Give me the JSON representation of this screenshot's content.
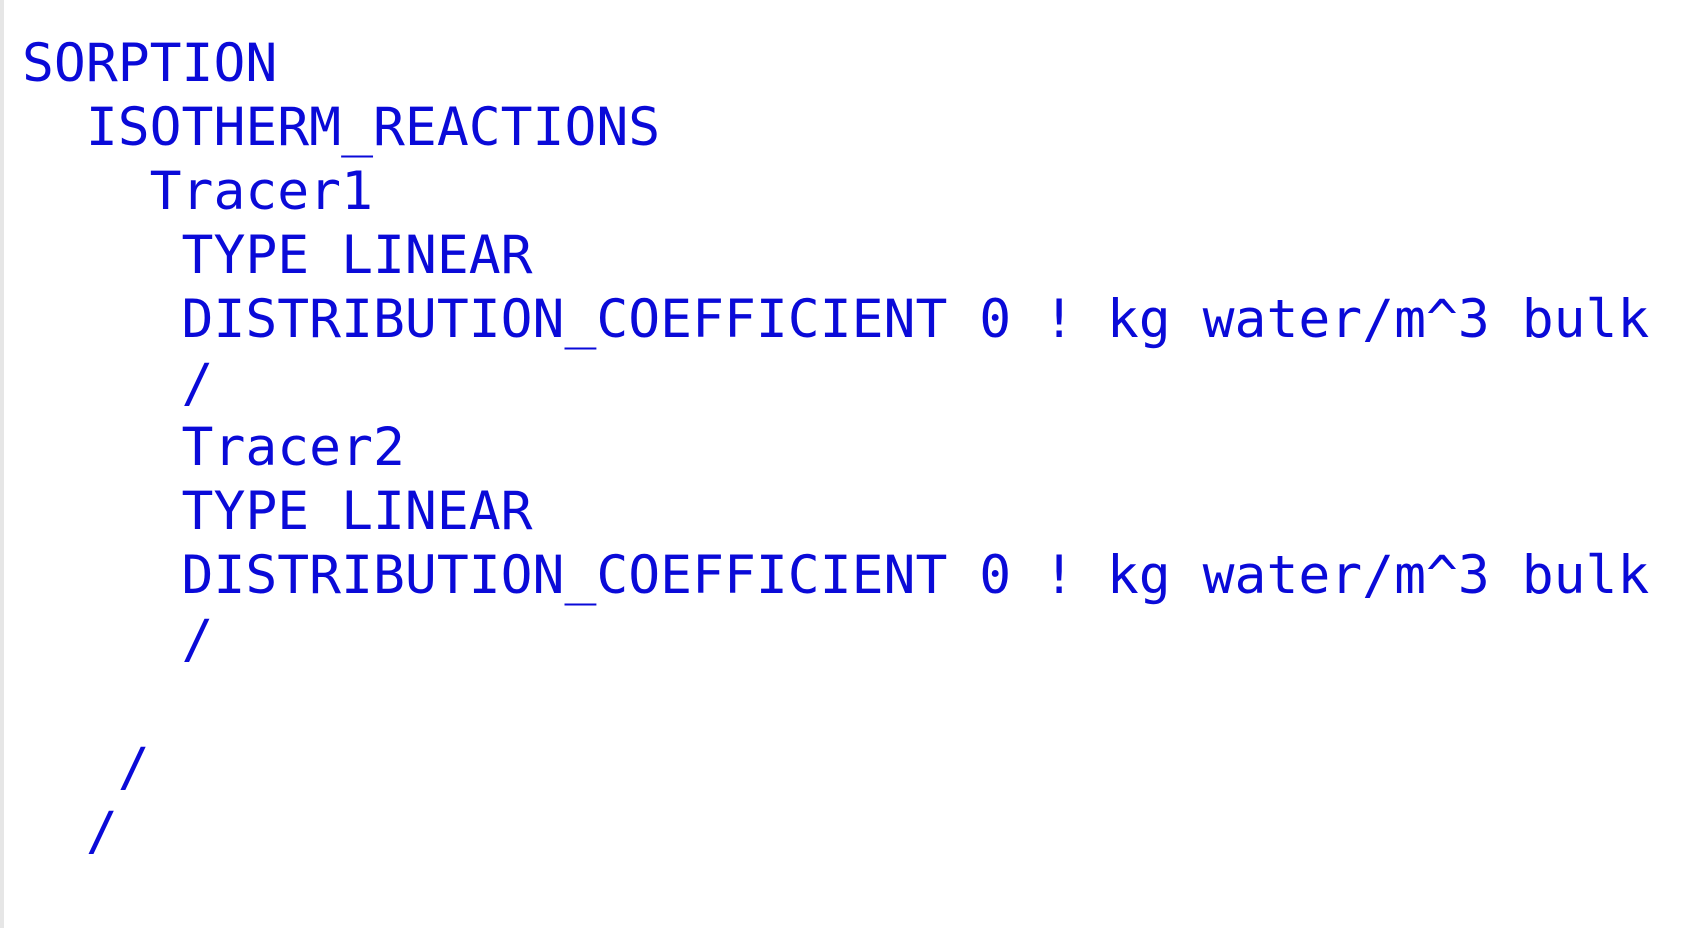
{
  "document": {
    "lines": [
      "SORPTION",
      "  ISOTHERM_REACTIONS",
      "    Tracer1",
      "     TYPE LINEAR",
      "     DISTRIBUTION_COEFFICIENT 0 ! kg water/m^3 bulk",
      "     /",
      "     Tracer2",
      "     TYPE LINEAR",
      "     DISTRIBUTION_COEFFICIENT 0 ! kg water/m^3 bulk",
      "     /",
      "",
      "   /",
      "  /"
    ]
  },
  "colors": {
    "text": "#0a0ad8",
    "background": "#ffffff",
    "gutter_border": "#e6e6e6"
  }
}
